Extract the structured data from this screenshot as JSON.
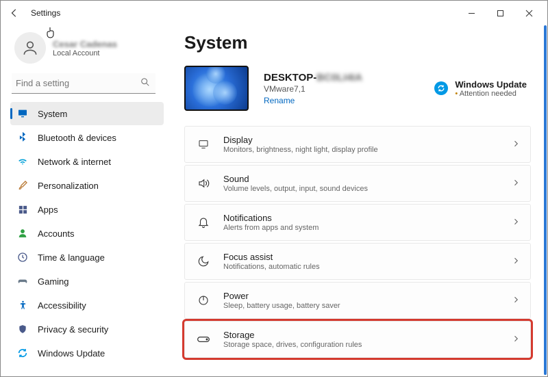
{
  "window": {
    "title": "Settings"
  },
  "account": {
    "name": "Cesar Cadenas",
    "sub": "Local Account"
  },
  "search": {
    "placeholder": "Find a setting"
  },
  "sidebar": {
    "items": [
      {
        "label": "System",
        "icon": "monitor",
        "color": "#0067c0",
        "active": true
      },
      {
        "label": "Bluetooth & devices",
        "icon": "bluetooth",
        "color": "#0067c0"
      },
      {
        "label": "Network & internet",
        "icon": "wifi",
        "color": "#00a0d8"
      },
      {
        "label": "Personalization",
        "icon": "brush",
        "color": "#b97b38"
      },
      {
        "label": "Apps",
        "icon": "apps",
        "color": "#4a5a8a"
      },
      {
        "label": "Accounts",
        "icon": "person",
        "color": "#2ea043"
      },
      {
        "label": "Time & language",
        "icon": "clock",
        "color": "#4a5a8a"
      },
      {
        "label": "Gaming",
        "icon": "gaming",
        "color": "#6a7a8a"
      },
      {
        "label": "Accessibility",
        "icon": "access",
        "color": "#0067c0"
      },
      {
        "label": "Privacy & security",
        "icon": "shield",
        "color": "#4a5a8a"
      },
      {
        "label": "Windows Update",
        "icon": "update",
        "color": "#0099e5"
      }
    ]
  },
  "page": {
    "title": "System"
  },
  "device": {
    "name_prefix": "DESKTOP-",
    "name_suffix": "BC0LI4IA",
    "sub": "VMware7,1",
    "rename": "Rename"
  },
  "update": {
    "title": "Windows Update",
    "sub": "Attention needed"
  },
  "cards": [
    {
      "icon": "display",
      "title": "Display",
      "sub": "Monitors, brightness, night light, display profile"
    },
    {
      "icon": "sound",
      "title": "Sound",
      "sub": "Volume levels, output, input, sound devices"
    },
    {
      "icon": "bell",
      "title": "Notifications",
      "sub": "Alerts from apps and system"
    },
    {
      "icon": "moon",
      "title": "Focus assist",
      "sub": "Notifications, automatic rules"
    },
    {
      "icon": "power",
      "title": "Power",
      "sub": "Sleep, battery usage, battery saver"
    },
    {
      "icon": "storage",
      "title": "Storage",
      "sub": "Storage space, drives, configuration rules",
      "highlight": true
    }
  ]
}
